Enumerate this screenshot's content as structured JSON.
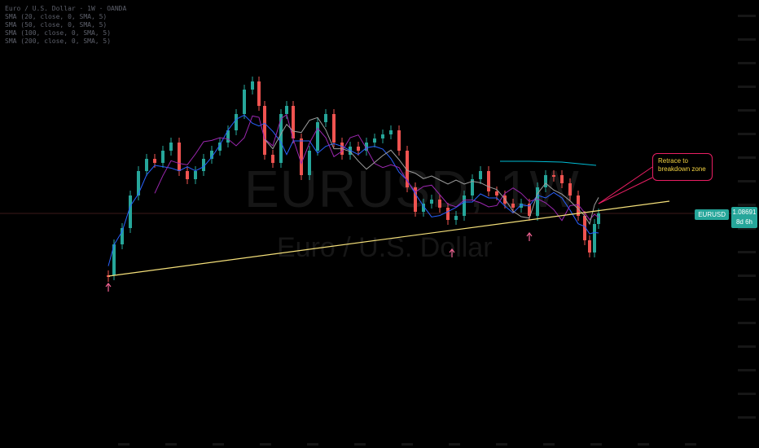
{
  "legend": {
    "lines": [
      "Euro / U.S. Dollar · 1W · OANDA",
      "SMA (20, close, 0, SMA, 5)",
      "SMA (50, close, 0, SMA, 5)",
      "SMA (100, close, 0, SMA, 5)",
      "SMA (200, close, 0, SMA, 5)"
    ]
  },
  "watermark": {
    "symbol": "EURUSD, 1W",
    "name": "Euro / U.S. Dollar"
  },
  "price_label": {
    "symbol": "EURUSD",
    "value": "1.08691",
    "countdown": "8d 6h"
  },
  "annotation": {
    "text_line1": "Retrace to",
    "text_line2": "breakdown zone"
  },
  "colors": {
    "up_candle": "#26a69a",
    "down_candle": "#ef5350",
    "trendline": "#f5e07a",
    "sma_blue": "#2962ff",
    "sma_purple": "#9c27b0",
    "sma_grey": "#9e9e9e",
    "sma_teal": "#00bcd4",
    "arrow": "#f06292",
    "annotation_border": "#e91e63",
    "price_line": "#3d1a1a"
  }
}
